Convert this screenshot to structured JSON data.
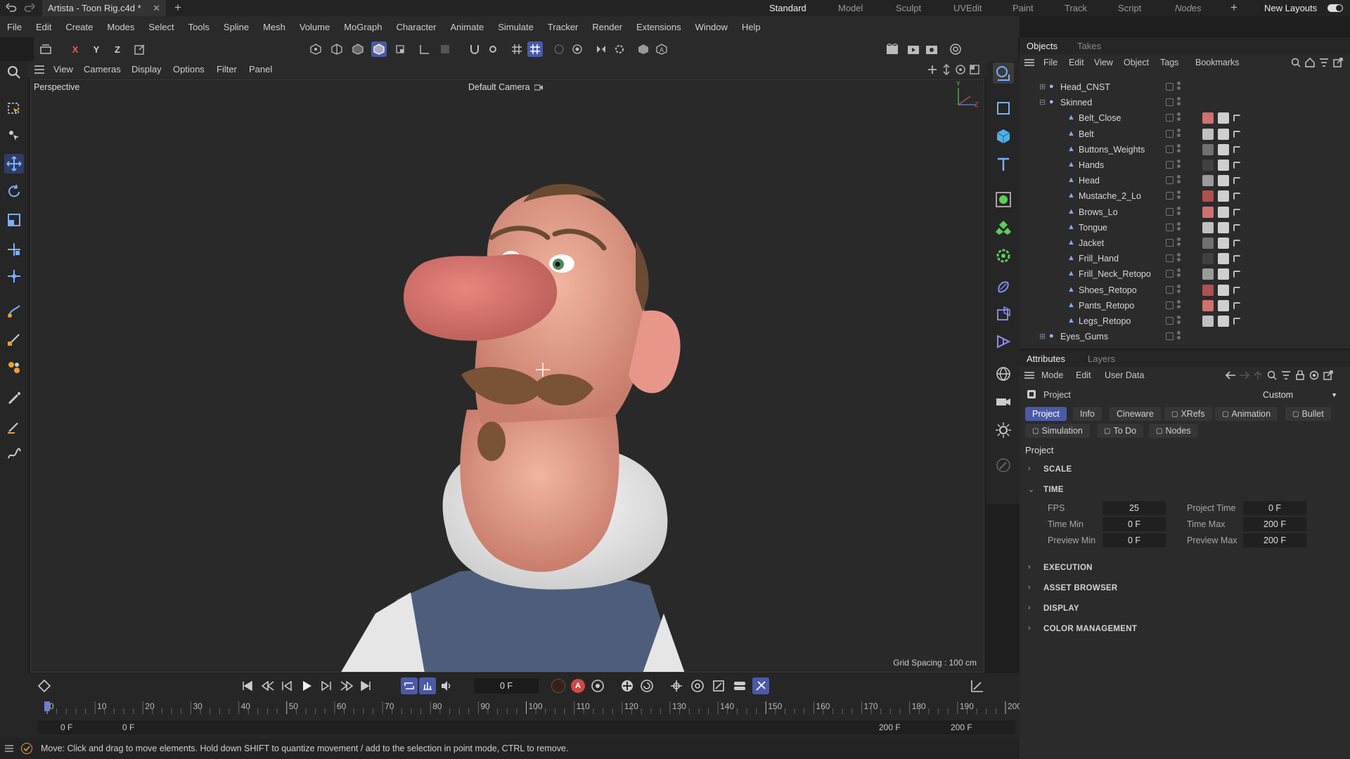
{
  "titlebar": {
    "doc_tab": "Artista - Toon Rig.c4d *",
    "layouts": [
      "Standard",
      "Model",
      "Sculpt",
      "UVEdit",
      "Paint",
      "Track",
      "Script",
      "Nodes"
    ],
    "active_layout": "Standard",
    "new_layouts": "New Layouts"
  },
  "menubar": [
    "File",
    "Edit",
    "Create",
    "Modes",
    "Select",
    "Tools",
    "Spline",
    "Mesh",
    "Volume",
    "MoGraph",
    "Character",
    "Animate",
    "Simulate",
    "Tracker",
    "Render",
    "Extensions",
    "Window",
    "Help"
  ],
  "toolbar": {
    "axis_x": "X",
    "axis_y": "Y",
    "axis_z": "Z"
  },
  "viewport_menu": [
    "View",
    "Cameras",
    "Display",
    "Options",
    "Filter",
    "Panel"
  ],
  "viewport": {
    "view_name": "Perspective",
    "camera": "Default Camera",
    "grid_spacing": "Grid Spacing : 100 cm",
    "axis_y": "Y",
    "axis_z": "Z"
  },
  "timeline": {
    "current_frame": "0 F",
    "ticks": [
      "0",
      "10",
      "20",
      "30",
      "40",
      "50",
      "60",
      "70",
      "80",
      "90",
      "100",
      "110",
      "120",
      "130",
      "140",
      "150",
      "160",
      "170",
      "180",
      "190",
      "200"
    ],
    "range_start": "0 F",
    "range_start2": "0 F",
    "range_end": "200 F",
    "range_end2": "200 F"
  },
  "status": "Move: Click and drag to move elements. Hold down SHIFT to quantize movement / add to the selection in point mode, CTRL to remove.",
  "objects_panel": {
    "tabs": [
      "Objects",
      "Takes"
    ],
    "menu": [
      "File",
      "Edit",
      "View",
      "Object",
      "Tags",
      "Bookmarks"
    ],
    "items": [
      {
        "name": "Head_CNST",
        "indent": 1
      },
      {
        "name": "Skinned",
        "indent": 1
      },
      {
        "name": "Belt_Close",
        "indent": 2
      },
      {
        "name": "Belt",
        "indent": 2
      },
      {
        "name": "Buttons_Weights",
        "indent": 2
      },
      {
        "name": "Hands",
        "indent": 2
      },
      {
        "name": "Head",
        "indent": 2
      },
      {
        "name": "Mustache_2_Lo",
        "indent": 2
      },
      {
        "name": "Brows_Lo",
        "indent": 2
      },
      {
        "name": "Tongue",
        "indent": 2
      },
      {
        "name": "Jacket",
        "indent": 2
      },
      {
        "name": "Frill_Hand",
        "indent": 2
      },
      {
        "name": "Frill_Neck_Retopo",
        "indent": 2
      },
      {
        "name": "Shoes_Retopo",
        "indent": 2
      },
      {
        "name": "Pants_Retopo",
        "indent": 2
      },
      {
        "name": "Legs_Retopo",
        "indent": 2
      },
      {
        "name": "Eyes_Gums",
        "indent": 1
      }
    ]
  },
  "attributes_panel": {
    "tabs": [
      "Attributes",
      "Layers"
    ],
    "menu": [
      "Mode",
      "Edit",
      "User Data"
    ],
    "object_label": "Project",
    "preset": "Custom",
    "tab_row1": [
      "Project",
      "Info",
      "Cineware",
      "XRefs",
      "Animation",
      "Bullet"
    ],
    "tab_row2": [
      "Simulation",
      "To Do",
      "Nodes"
    ],
    "section_title": "Project",
    "sections": {
      "scale": "SCALE",
      "time": "TIME",
      "execution": "EXECUTION",
      "asset_browser": "ASSET BROWSER",
      "display": "DISPLAY",
      "color_management": "COLOR MANAGEMENT"
    },
    "time_fields": {
      "fps_label": "FPS",
      "fps": "25",
      "project_time_label": "Project Time",
      "project_time": "0 F",
      "time_min_label": "Time Min",
      "time_min": "0 F",
      "time_max_label": "Time Max",
      "time_max": "200 F",
      "preview_min_label": "Preview Min",
      "preview_min": "0 F",
      "preview_max_label": "Preview Max",
      "preview_max": "200 F"
    }
  },
  "colors": {
    "accent": "#4a5aa8",
    "bg": "#1e1e1e",
    "panel": "#2b2b2b"
  }
}
